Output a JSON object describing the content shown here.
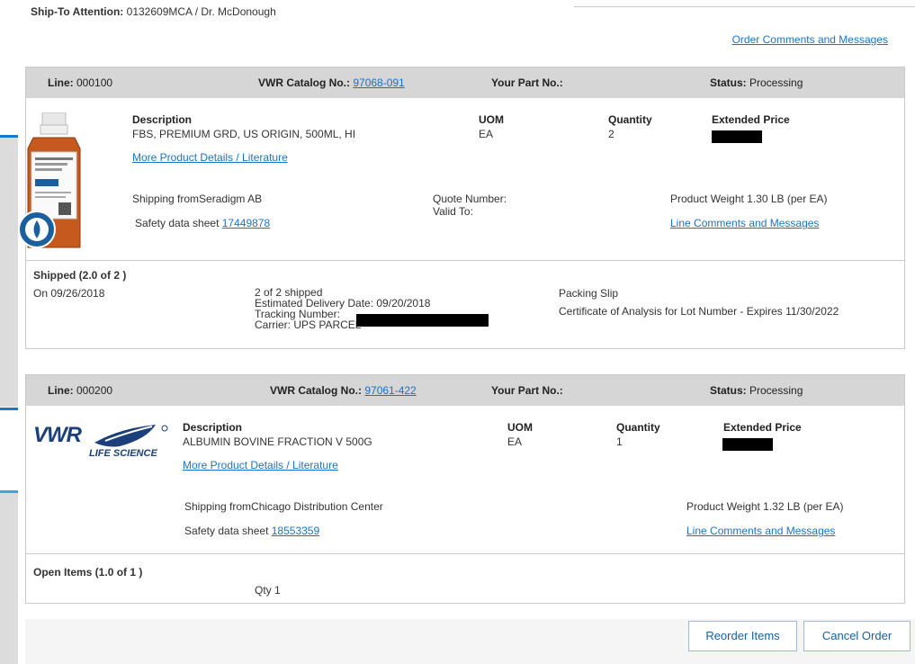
{
  "header": {
    "ship_to_label": "Ship-To Attention:",
    "ship_to_value": " 0132609MCA / Dr. McDonough",
    "order_comments": "Order Comments and Messages"
  },
  "lines": [
    {
      "line_label": "Line:",
      "line_no": " 000100",
      "catalog_label": "VWR Catalog No.:",
      "catalog_no": "97068-091",
      "part_label": "Your Part No.:",
      "status_label": "Status:",
      "status_value": " Processing",
      "description_head": "Description",
      "description": "FBS, PREMIUM GRD, US ORIGIN, 500ML, HI",
      "details_link": "More Product Details / Literature",
      "uom_head": "UOM",
      "uom": "EA",
      "qty_head": "Quantity",
      "qty": "2",
      "price_head": "Extended Price",
      "shipping_from": "Shipping fromSeradigm AB",
      "sds_label": "Safety data sheet",
      "sds_no": "17449878",
      "quote_number": "Quote Number:",
      "valid_to": "Valid To:",
      "weight": "Product Weight 1.30 LB (per EA)",
      "line_comments": "Line Comments and Messages",
      "fulfillment_title": "Shipped (2.0 of 2 )",
      "fulfillment_date": "On 09/26/2018",
      "shipped_count": "2 of 2 shipped",
      "est_delivery": "Estimated Delivery Date: 09/20/2018",
      "tracking": "Tracking Number:",
      "carrier": "Carrier: UPS PARCEL",
      "packing_slip": "Packing Slip",
      "coa": "Certificate of Analysis for Lot Number  - Expires  11/30/2022"
    },
    {
      "line_label": "Line:",
      "line_no": " 000200",
      "catalog_label": "VWR Catalog No.:",
      "catalog_no": "97061-422",
      "part_label": "Your Part No.:",
      "status_label": "Status:",
      "status_value": " Processing",
      "description_head": "Description",
      "description": "ALBUMIN BOVINE FRACTION V 500G",
      "details_link": "More Product Details / Literature",
      "uom_head": "UOM",
      "uom": "EA",
      "qty_head": "Quantity",
      "qty": "1",
      "price_head": "Extended Price",
      "shipping_from": "Shipping fromChicago Distribution Center",
      "sds_label": "Safety data sheet",
      "sds_no": "18553359",
      "weight": "Product Weight 1.32 LB (per EA)",
      "line_comments": "Line Comments and Messages",
      "fulfillment_title": "Open Items (1.0 of 1 )",
      "open_qty": "Qty 1",
      "logo_text": "VWR",
      "logo_sub": "LIFE SCIENCE"
    }
  ],
  "actions": {
    "reorder": "Reorder Items",
    "cancel": "Cancel Order"
  },
  "colors": {
    "link": "#1a73c8",
    "header_bg": "#d6d6d6",
    "button_text": "#1a5f9e",
    "accent": "#1479c9"
  },
  "icons": {
    "bottle": "fbs-bottle-product-image",
    "logo": "vwr-life-science-logo"
  }
}
